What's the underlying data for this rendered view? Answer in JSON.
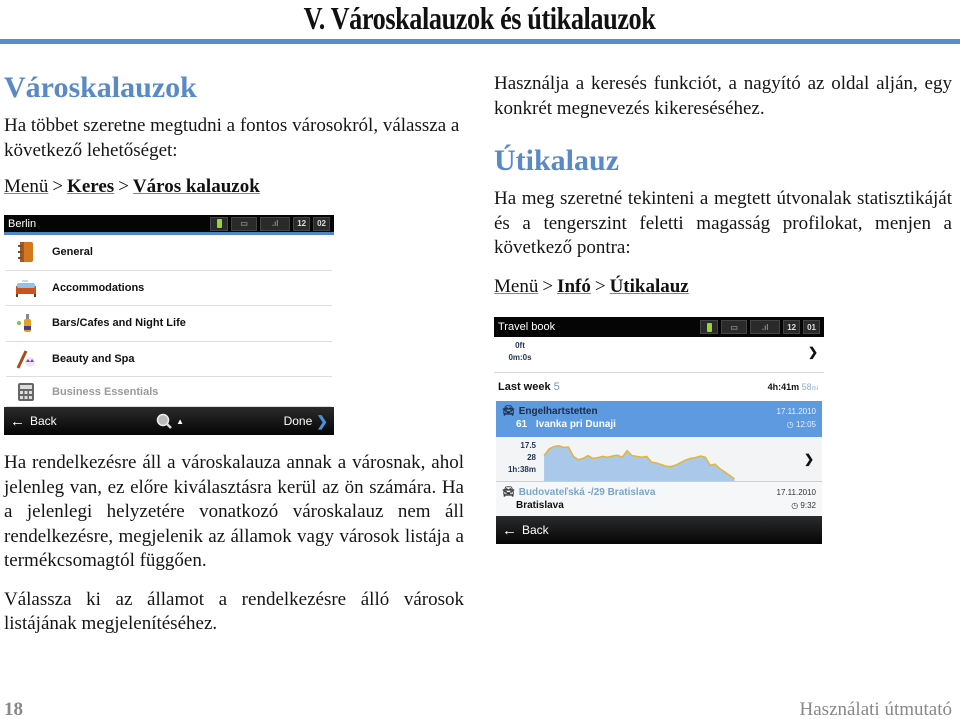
{
  "page": {
    "title": "V. Városkalauzok és útikalauzok",
    "page_number": "18",
    "footer_title": "Használati útmutató",
    "accent_color": "#5b8dc9"
  },
  "left": {
    "heading": "Városkalauzok",
    "intro": "Ha többet szeretne megtudni a fontos városokról, válassza a következő lehetőséget:",
    "path": {
      "items": [
        "Menü",
        "Keres",
        "Város kalauzok"
      ],
      "separator": ">"
    },
    "para1": "Ha rendelkezésre áll a városkalauza annak a városnak, ahol jelenleg van, ez előre kiválasztásra kerül az ön számára.  Ha a jelenlegi helyzetére vonatkozó városkalauz nem áll rendelkezésre, megjelenik az államok vagy városok listája a termékcsomagtól függően.",
    "para2": "Válassza ki az államot a rendelkezésre álló városok listájának megjelenítéséhez."
  },
  "city_screen": {
    "title": "Berlin",
    "status": {
      "time_h": "12",
      "time_m": "02",
      "gps": "GPS",
      "signal": "sig"
    },
    "items": [
      {
        "label": "General",
        "icon": "address-book-icon",
        "enabled": true
      },
      {
        "label": "Accommodations",
        "icon": "bed-icon",
        "enabled": true
      },
      {
        "label": "Bars/Cafes and Night Life",
        "icon": "drinks-icon",
        "enabled": true
      },
      {
        "label": "Beauty and Spa",
        "icon": "spa-icon",
        "enabled": true
      },
      {
        "label": "Business Essentials",
        "icon": "calculator-icon",
        "enabled": false
      }
    ],
    "bottom": {
      "back": "Back",
      "done": "Done"
    }
  },
  "right": {
    "search_hint": "Használja a keresés funkciót, a nagyító az oldal alján, egy konkrét megnevezés kikereséséhez.",
    "heading": "Útikalauz",
    "intro": "Ha meg szeretné tekinteni a megtett útvonalak statisztikáját és a tengerszint feletti magasság profilokat, menjen a következő pontra:",
    "path": {
      "items": [
        "Menü",
        "Infó",
        "Útikalauz"
      ],
      "separator": ">"
    }
  },
  "travel_screen": {
    "title": "Travel book",
    "status": {
      "time_h": "12",
      "time_m": "01"
    },
    "current": {
      "distance": "0ft",
      "duration": "0m:0s"
    },
    "last_week": {
      "label": "Last week",
      "count": "5",
      "duration": "4h:41m",
      "distance": "58",
      "distance_unit": "mi"
    },
    "trips": [
      {
        "from": "Engelhartstetten",
        "index": "61",
        "to": "Ivanka pri Dunaji",
        "date": "17.11.2010",
        "time": "12:05",
        "stats": {
          "distance": "17.5",
          "elevation": "28",
          "duration": "1h:38m"
        },
        "elevation_profile": [
          62,
          78,
          84,
          86,
          82,
          83,
          60,
          52,
          55,
          62,
          55,
          57,
          60,
          58,
          61,
          63,
          58,
          74,
          62,
          60,
          58,
          60,
          46,
          44,
          40,
          36,
          35,
          39,
          45,
          51,
          55,
          57,
          61,
          58,
          38,
          41,
          30,
          22,
          14,
          5
        ]
      },
      {
        "from": "Budovateľská -/29  Bratislava",
        "to": "Bratislava",
        "date": "17.11.2010",
        "time": "9:32"
      }
    ],
    "bottom": {
      "back": "Back"
    }
  }
}
